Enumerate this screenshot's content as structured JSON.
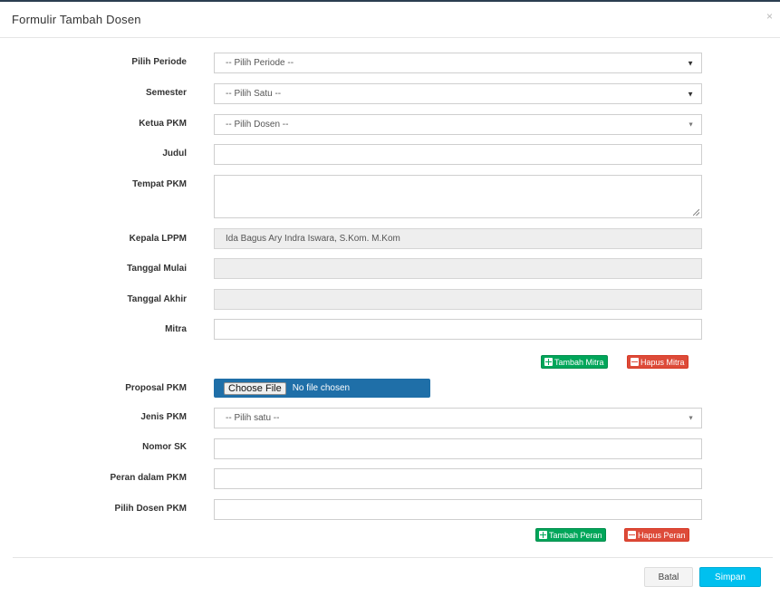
{
  "modal": {
    "title": "Formulir Tambah Dosen",
    "close": "×"
  },
  "form": {
    "periode": {
      "label": "Pilih Periode",
      "value": "-- Pilih Periode --"
    },
    "semester": {
      "label": "Semester",
      "value": "-- Pilih Satu --"
    },
    "ketua": {
      "label": "Ketua PKM",
      "value": "-- Pilih Dosen --"
    },
    "judul": {
      "label": "Judul",
      "value": ""
    },
    "tempat": {
      "label": "Tempat PKM",
      "value": ""
    },
    "kepala": {
      "label": "Kepala LPPM",
      "value": "Ida Bagus Ary Indra Iswara, S.Kom. M.Kom"
    },
    "tanggal_mulai": {
      "label": "Tanggal Mulai",
      "value": ""
    },
    "tanggal_akhir": {
      "label": "Tanggal Akhir",
      "value": ""
    },
    "mitra": {
      "label": "Mitra",
      "value": ""
    },
    "tambah_mitra": "Tambah Mitra",
    "hapus_mitra": "Hapus Mitra",
    "proposal": {
      "label": "Proposal PKM",
      "button": "Choose File",
      "status": "No file chosen"
    },
    "jenis": {
      "label": "Jenis PKM",
      "value": "-- Pilih satu --"
    },
    "nomor_sk": {
      "label": "Nomor SK",
      "value": ""
    },
    "peran": {
      "label": "Peran dalam PKM",
      "value": ""
    },
    "dosen_pkm": {
      "label": "Pilih Dosen PKM",
      "value": ""
    },
    "tambah_peran": "Tambah Peran",
    "hapus_peran": "Hapus Peran"
  },
  "footer": {
    "batal": "Batal",
    "simpan": "Simpan"
  },
  "colors": {
    "primary": "#00c0ef",
    "success": "#00a65a",
    "danger": "#dd4b39",
    "file_bg": "#1f6fa8"
  },
  "icons": {
    "dropdown": "caret-down-icon",
    "add": "plus-square-icon",
    "remove": "minus-square-icon",
    "close": "close-icon"
  }
}
